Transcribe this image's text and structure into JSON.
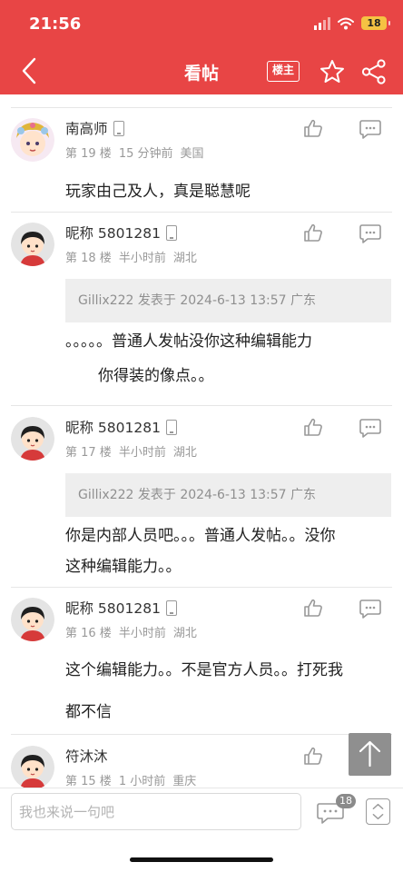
{
  "status_bar": {
    "time": "21:56",
    "battery": "18"
  },
  "nav": {
    "title": "看帖",
    "landlord_label": "楼主"
  },
  "posts": [
    {
      "name": "南高师",
      "floor": "第 19 楼",
      "time": "15 分钟前",
      "location": "美国",
      "content": [
        "玩家由己及人，真是聪慧呢"
      ]
    },
    {
      "name": "昵称 5801281",
      "floor": "第 18 楼",
      "time": "半小时前",
      "location": "湖北",
      "quote": "Gillix222 发表于 2024-6-13 13:57 广东",
      "content": [
        "。。。。。普通人发帖没你这种编辑能力",
        "你得装的像点。。"
      ]
    },
    {
      "name": "昵称 5801281",
      "floor": "第 17 楼",
      "time": "半小时前",
      "location": "湖北",
      "quote": "Gillix222 发表于 2024-6-13 13:57 广东",
      "content": [
        "你是内部人员吧。。。普通人发帖。。没你",
        "这种编辑能力。。"
      ]
    },
    {
      "name": "昵称 5801281",
      "floor": "第 16 楼",
      "time": "半小时前",
      "location": "湖北",
      "content": [
        "这个编辑能力。。不是官方人员。。打死我",
        "都不信"
      ]
    },
    {
      "name": "符沐沐",
      "floor": "第 15 楼",
      "time": "1 小时前",
      "location": "重庆"
    }
  ],
  "bottom": {
    "placeholder": "我也来说一句吧",
    "comment_count": "18"
  },
  "colors": {
    "brand_red": "#e84545",
    "quote_bg": "#eeeeee",
    "meta_gray": "#999999"
  }
}
